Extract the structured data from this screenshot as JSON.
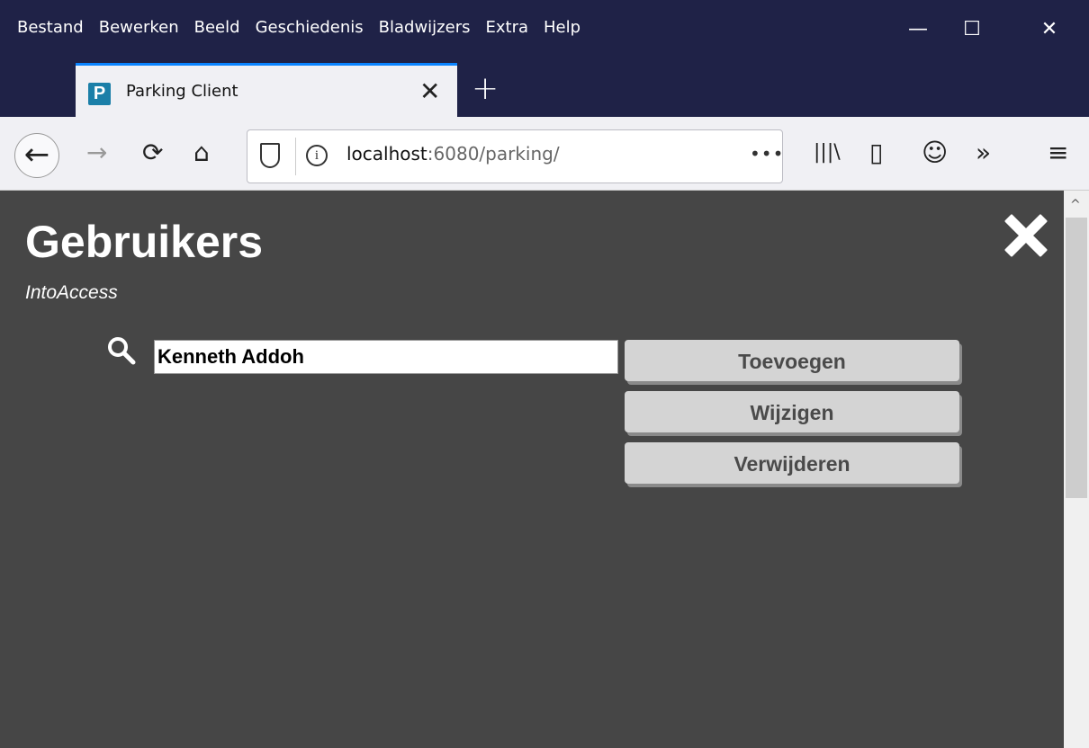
{
  "menu": [
    "Bestand",
    "Bewerken",
    "Beeld",
    "Geschiedenis",
    "Bladwijzers",
    "Extra",
    "Help"
  ],
  "tab": {
    "favicon": "P",
    "title": "Parking Client",
    "close": "✕"
  },
  "newtab": "+",
  "url": {
    "host": "localhost",
    "path": ":6080/parking/",
    "more": "•••"
  },
  "icons": {
    "back": "←",
    "forward": "→",
    "reload": "⟳",
    "home": "⌂",
    "library": "|||\\",
    "sidebar": "▯",
    "account": "☺",
    "overflow": "»",
    "menu": "≡"
  },
  "window": {
    "minimize": "—",
    "maximize": "☐",
    "close": "✕"
  },
  "page": {
    "title": "Gebruikers",
    "subtitle": "IntoAccess",
    "search_value": "Kenneth Addoh",
    "buttons": {
      "add": "Toevoegen",
      "edit": "Wijzigen",
      "delete": "Verwijderen"
    }
  },
  "colors": {
    "chrome": "#1f2247",
    "page_bg": "#464646",
    "tab_accent": "#0a84ff",
    "button_bg": "#d4d4d4"
  }
}
